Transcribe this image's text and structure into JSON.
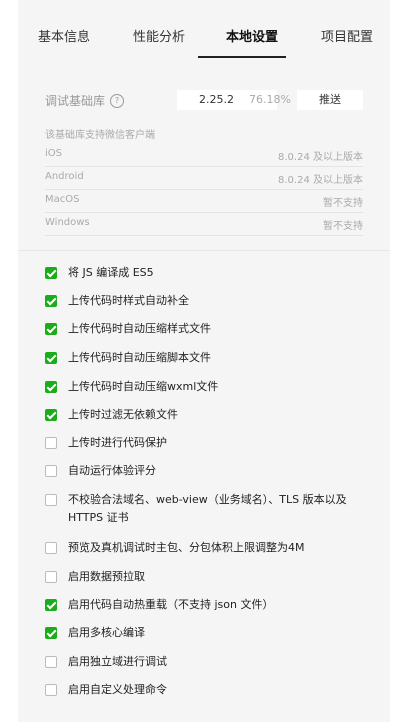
{
  "tabs": [
    {
      "label": "基本信息",
      "active": false
    },
    {
      "label": "性能分析",
      "active": false
    },
    {
      "label": "本地设置",
      "active": true
    },
    {
      "label": "项目配置",
      "active": false
    }
  ],
  "library": {
    "label": "调试基础库",
    "help_icon": "?",
    "version": "2.25.2",
    "percent": "76.18%",
    "push_label": "推送"
  },
  "clients": {
    "title": "该基础库支持微信客户端",
    "rows": [
      {
        "name": "iOS",
        "status": "8.0.24 及以上版本"
      },
      {
        "name": "Android",
        "status": "8.0.24 及以上版本"
      },
      {
        "name": "MacOS",
        "status": "暂不支持"
      },
      {
        "name": "Windows",
        "status": "暂不支持"
      }
    ]
  },
  "options": [
    {
      "label": "将 JS 编译成 ES5",
      "checked": true
    },
    {
      "label": "上传代码时样式自动补全",
      "checked": true
    },
    {
      "label": "上传代码时自动压缩样式文件",
      "checked": true
    },
    {
      "label": "上传代码时自动压缩脚本文件",
      "checked": true
    },
    {
      "label": "上传代码时自动压缩wxml文件",
      "checked": true
    },
    {
      "label": "上传时过滤无依赖文件",
      "checked": true
    },
    {
      "label": "上传时进行代码保护",
      "checked": false
    },
    {
      "label": "自动运行体验评分",
      "checked": false
    },
    {
      "label": "不校验合法域名、web-view（业务域名）、TLS 版本以及 HTTPS 证书",
      "checked": false
    },
    {
      "label": "预览及真机调试时主包、分包体积上限调整为4M",
      "checked": false
    },
    {
      "label": "启用数据预拉取",
      "checked": false
    },
    {
      "label": "启用代码自动热重载（不支持 json 文件）",
      "checked": true
    },
    {
      "label": "启用多核心编译",
      "checked": true
    },
    {
      "label": "启用独立域进行调试",
      "checked": false
    },
    {
      "label": "启用自定义处理命令",
      "checked": false
    }
  ],
  "colors": {
    "checkbox_on": "#1aad19",
    "panel_bg": "#f5f5f5"
  }
}
